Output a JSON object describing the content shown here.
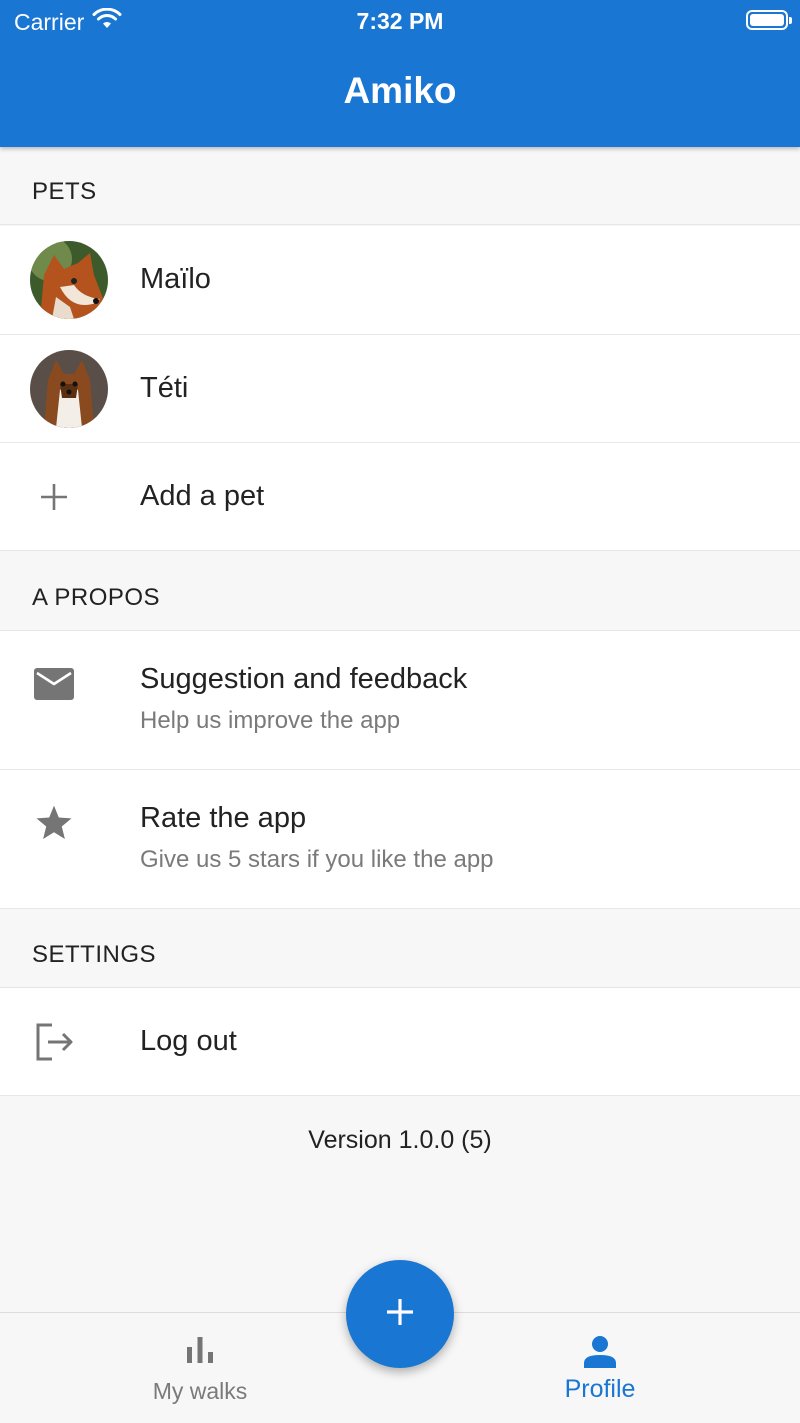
{
  "status_bar": {
    "carrier": "Carrier",
    "time": "7:32 PM"
  },
  "header": {
    "title": "Amiko"
  },
  "pets": {
    "header": "PETS",
    "items": [
      {
        "name": "Maïlo"
      },
      {
        "name": "Téti"
      }
    ],
    "add_label": "Add a pet"
  },
  "about": {
    "header": "A PROPOS",
    "feedback": {
      "title": "Suggestion and feedback",
      "subtitle": "Help us improve the app"
    },
    "rate": {
      "title": "Rate the app",
      "subtitle": "Give us 5 stars if you like the app"
    }
  },
  "settings": {
    "header": "SETTINGS",
    "logout_label": "Log out"
  },
  "version": "Version 1.0.0 (5)",
  "bottom_nav": {
    "items": [
      {
        "label": "My walks",
        "icon": "bar-chart-icon",
        "active": false
      },
      {
        "label": "Profile",
        "icon": "person-icon",
        "active": true
      }
    ]
  },
  "fab": {
    "icon": "plus-icon"
  },
  "colors": {
    "primary": "#1976d2",
    "icon_gray": "#757575",
    "inactive_label": "#7a7a7a"
  }
}
